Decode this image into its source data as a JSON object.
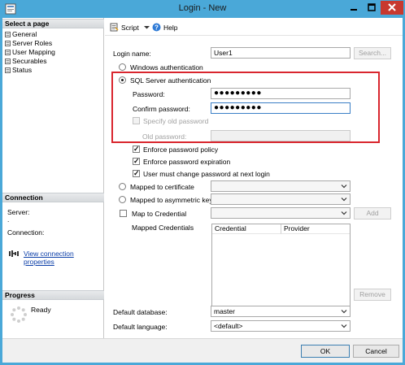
{
  "window": {
    "title": "Login - New"
  },
  "left_panel": {
    "select_page_header": "Select a page",
    "pages": [
      "General",
      "Server Roles",
      "User Mapping",
      "Securables",
      "Status"
    ],
    "connection_header": "Connection",
    "server_label": "Server:",
    "server_value": ".",
    "connection_label": "Connection:",
    "view_properties_link": "View connection properties",
    "progress_header": "Progress",
    "progress_status": "Ready"
  },
  "toolbar": {
    "script_label": "Script",
    "help_label": "Help"
  },
  "form": {
    "login_name_label": "Login name:",
    "login_name_value": "User1",
    "search_button": "Search...",
    "windows_auth_label": "Windows authentication",
    "sql_auth_label": "SQL Server authentication",
    "password_label": "Password:",
    "password_value": "●●●●●●●●●",
    "confirm_password_label": "Confirm password:",
    "confirm_password_value": "●●●●●●●●●",
    "specify_old_password_label": "Specify old password",
    "old_password_label": "Old password:",
    "enforce_policy_label": "Enforce password policy",
    "enforce_expiration_label": "Enforce password expiration",
    "must_change_label": "User must change password at next login",
    "mapped_certificate_label": "Mapped to certificate",
    "mapped_asymmetric_label": "Mapped to asymmetric key",
    "map_credential_label": "Map to Credential",
    "add_button": "Add",
    "mapped_credentials_label": "Mapped Credentials",
    "grid_columns": [
      "Credential",
      "Provider"
    ],
    "remove_button": "Remove",
    "default_database_label": "Default database:",
    "default_database_value": "master",
    "default_language_label": "Default language:",
    "default_language_value": "<default>"
  },
  "buttons": {
    "ok": "OK",
    "cancel": "Cancel"
  },
  "colors": {
    "titlebar": "#4aa8d8",
    "close": "#c7392f",
    "highlight": "#d9262e",
    "link": "#0b3ea8"
  }
}
